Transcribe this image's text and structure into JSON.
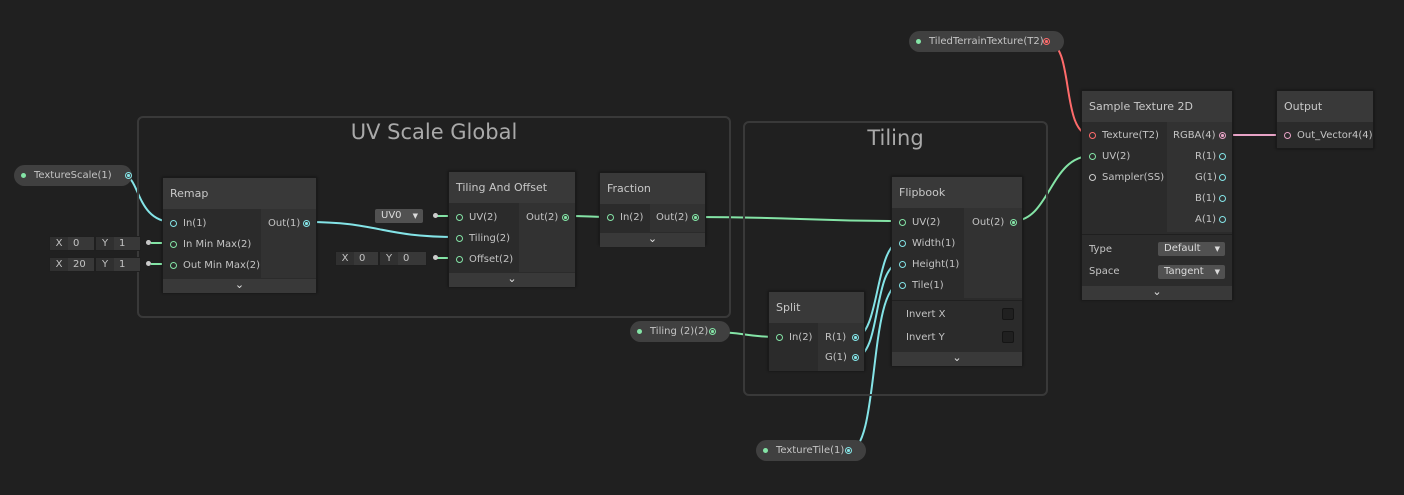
{
  "colors": {
    "float": "#84e4e7",
    "vec2": "#84e4a6",
    "texture": "#ff6b6b",
    "vec4": "#e7a3c6"
  },
  "groups": {
    "uv_scale_global": "UV Scale Global",
    "tiling": "Tiling"
  },
  "properties": {
    "texture_scale": "TextureScale(1)",
    "tiled_terrain_texture": "TiledTerrainTexture(T2)",
    "tiling2": "Tiling (2)(2)",
    "texture_tile": "TextureTile(1)"
  },
  "remap": {
    "title": "Remap",
    "in": "In(1)",
    "in_min_max": "In Min Max(2)",
    "out_min_max": "Out Min Max(2)",
    "out": "Out(1)",
    "in_min_x": "0",
    "in_min_y": "1",
    "out_min_x": "20",
    "out_min_y": "1"
  },
  "tiling_offset": {
    "title": "Tiling And Offset",
    "uv": "UV(2)",
    "tiling": "Tiling(2)",
    "offset": "Offset(2)",
    "out": "Out(2)",
    "uv_channel": "UV0",
    "offset_x": "0",
    "offset_y": "0"
  },
  "fraction": {
    "title": "Fraction",
    "in": "In(2)",
    "out": "Out(2)"
  },
  "flipbook": {
    "title": "Flipbook",
    "uv": "UV(2)",
    "width": "Width(1)",
    "height": "Height(1)",
    "tile": "Tile(1)",
    "out": "Out(2)",
    "invert_x": "Invert X",
    "invert_y": "Invert Y"
  },
  "split": {
    "title": "Split",
    "in": "In(2)",
    "r": "R(1)",
    "g": "G(1)"
  },
  "sample_texture": {
    "title": "Sample Texture 2D",
    "texture": "Texture(T2)",
    "uv": "UV(2)",
    "sampler": "Sampler(SS)",
    "rgba": "RGBA(4)",
    "r": "R(1)",
    "g": "G(1)",
    "b": "B(1)",
    "a": "A(1)",
    "type_label": "Type",
    "type_value": "Default",
    "space_label": "Space",
    "space_value": "Tangent"
  },
  "output": {
    "title": "Output",
    "out_vector": "Out_Vector4(4)"
  },
  "axis": {
    "x": "X",
    "y": "Y"
  },
  "chevron": "⌄"
}
